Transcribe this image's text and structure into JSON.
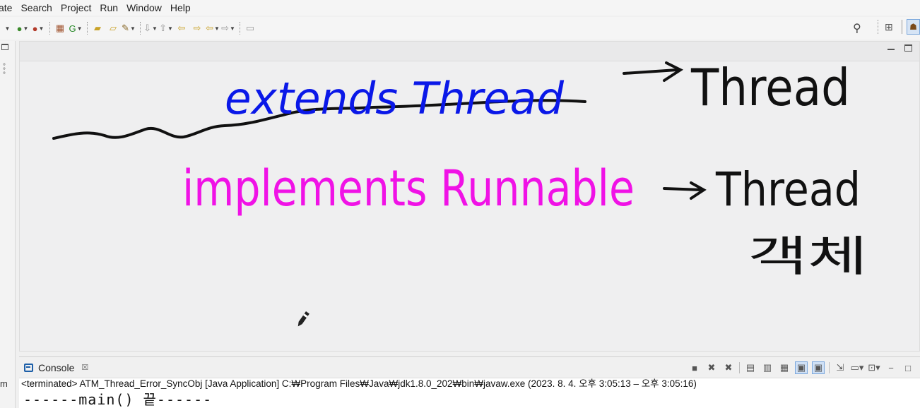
{
  "menubar": {
    "items": [
      "ate",
      "Search",
      "Project",
      "Run",
      "Window",
      "Help"
    ]
  },
  "toolbar": {
    "icons": [
      "debug-icon",
      "run-icon",
      "external-tools-icon",
      "new-java-package-icon",
      "coverage-icon",
      "open-type-icon",
      "open-task-icon",
      "search-icon",
      "next-annotation-icon",
      "previous-annotation-icon",
      "back-icon",
      "forward-icon",
      "last-edit-icon",
      "forward-history-icon",
      "pin-editor-icon"
    ],
    "search_icon": "search-icon",
    "perspective_icons": [
      "open-perspective-icon",
      "java-ee-perspective-icon"
    ]
  },
  "left_strip": {
    "label": "m"
  },
  "annotations": {
    "line1": "extends Thread",
    "line1_arrow_target": "Thread",
    "line2": "implements Runnable",
    "line2_arrow_target": "Thread",
    "line2_note": "객체",
    "colors": {
      "blue": "#0a18e8",
      "magenta": "#f012e6",
      "black": "#111111"
    }
  },
  "console": {
    "tab_label": "Console",
    "tab_close": "☒",
    "status": "<terminated> ATM_Thread_Error_SyncObj [Java Application] C:₩Program Files₩Java₩jdk1.8.0_202₩bin₩javaw.exe  (2023. 8. 4. 오후 3:05:13 – 오후 3:05:16)",
    "output_line": "------main() 끝------"
  }
}
